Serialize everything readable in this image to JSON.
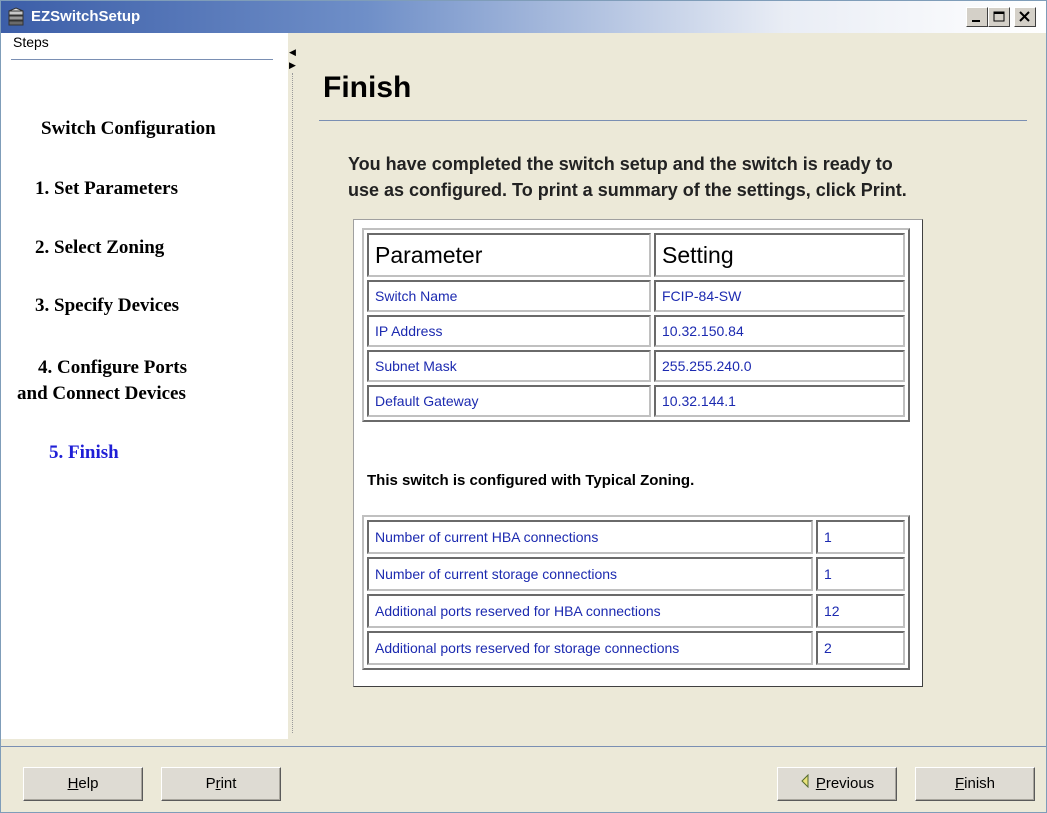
{
  "window": {
    "title": "EZSwitchSetup"
  },
  "sidebar": {
    "label": "Steps",
    "items": [
      {
        "label": "Switch Configuration",
        "active": false
      },
      {
        "label": "1. Set Parameters",
        "active": false
      },
      {
        "label": "2. Select Zoning",
        "active": false
      },
      {
        "label": "3. Specify Devices",
        "active": false
      },
      {
        "label_line1": "4. Configure Ports",
        "label_line2": "and Connect Devices",
        "active": false
      },
      {
        "label": "5. Finish",
        "active": true
      }
    ]
  },
  "main": {
    "title": "Finish",
    "intro_line1": "You have completed the switch setup and the switch is ready to",
    "intro_line2": "use as configured. To print a summary of the settings, click Print.",
    "params_table": {
      "headers": [
        "Parameter",
        "Setting"
      ],
      "rows": [
        [
          "Switch Name",
          "FCIP-84-SW"
        ],
        [
          "IP Address",
          "10.32.150.84"
        ],
        [
          "Subnet Mask",
          "255.255.240.0"
        ],
        [
          "Default Gateway",
          "10.32.144.1"
        ]
      ]
    },
    "zoning_note": "This switch is configured with Typical Zoning.",
    "connections_table": {
      "rows": [
        [
          "Number of current HBA connections",
          "1"
        ],
        [
          "Number of current storage connections",
          "1"
        ],
        [
          "Additional ports reserved for HBA connections",
          "12"
        ],
        [
          "Additional ports reserved for storage connections",
          "2"
        ]
      ]
    }
  },
  "buttons": {
    "help": {
      "hotkey": "H",
      "rest": "elp"
    },
    "print": {
      "pre": "P",
      "hotkey": "r",
      "rest": "int"
    },
    "previous": {
      "hotkey": "P",
      "rest": "revious"
    },
    "finish": {
      "hotkey": "F",
      "rest": "inish"
    }
  },
  "colors": {
    "active_step": "#1f1fd6",
    "cell_text": "#1c2ab0",
    "rule": "#7a8fb3"
  }
}
